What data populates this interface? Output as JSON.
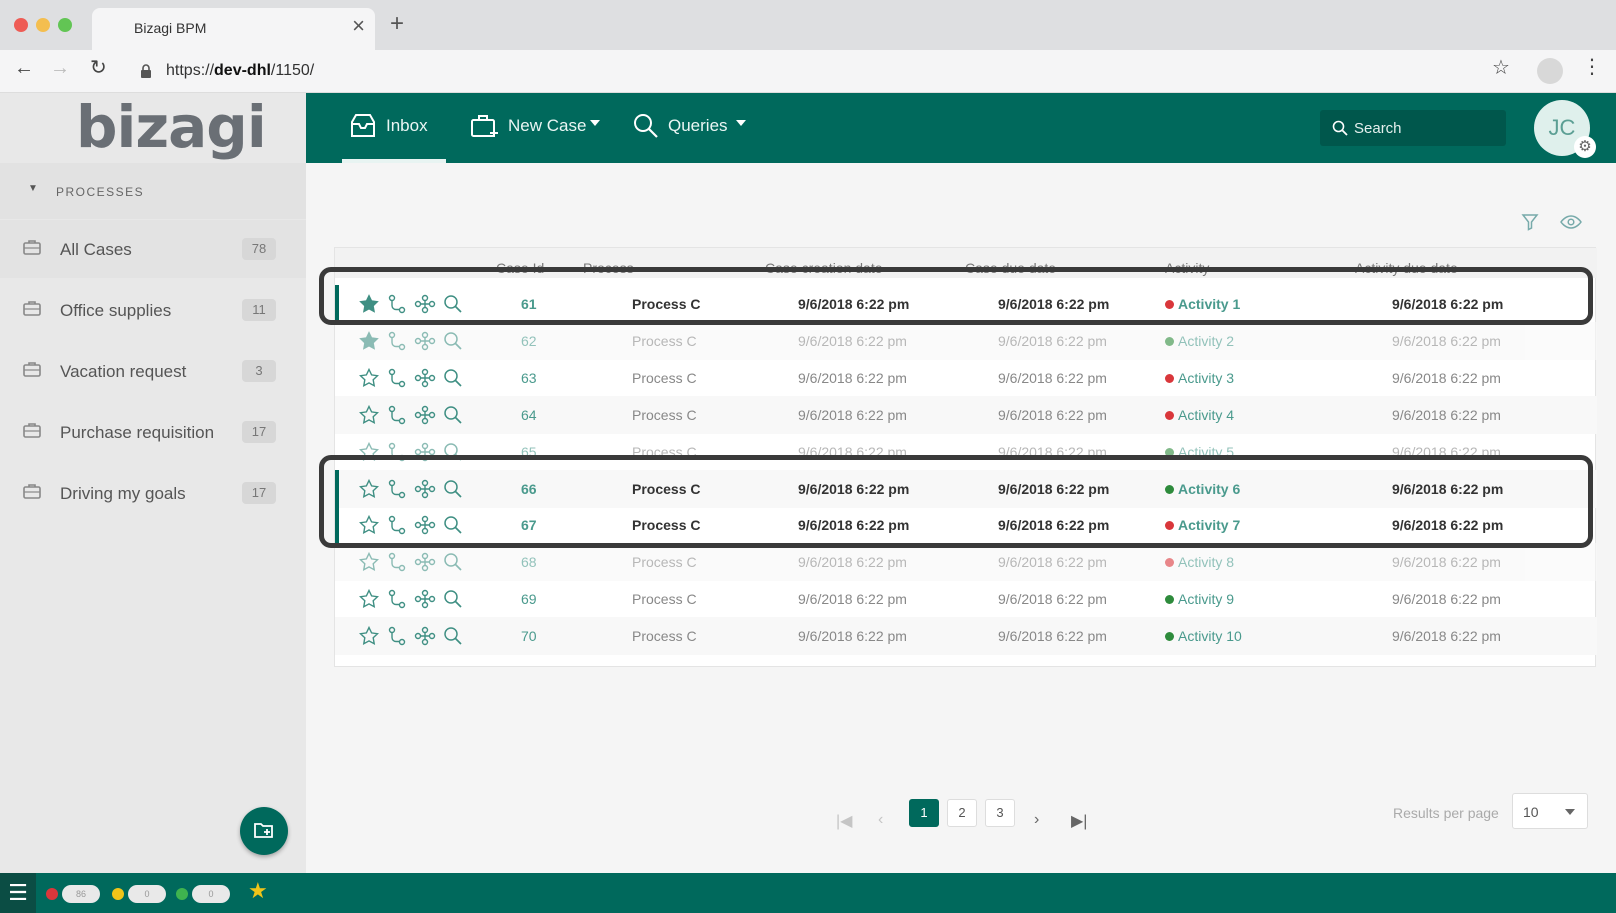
{
  "browser": {
    "tab_title": "Bizagi BPM",
    "url_prefix": "https://",
    "url_host": "dev-dhl",
    "url_path": "/1150/"
  },
  "sidebar": {
    "logo": "bizagi",
    "section_label": "PROCESSES",
    "items": [
      {
        "label": "All Cases",
        "count": "78"
      },
      {
        "label": "Office supplies",
        "count": "11"
      },
      {
        "label": "Vacation request",
        "count": "3"
      },
      {
        "label": "Purchase requisition",
        "count": "17"
      },
      {
        "label": "Driving my goals",
        "count": "17"
      }
    ]
  },
  "header": {
    "nav": [
      {
        "label": "Inbox",
        "icon": "inbox-icon",
        "active": true
      },
      {
        "label": "New Case",
        "icon": "briefcase-plus-icon"
      },
      {
        "label": "Queries",
        "icon": "search-icon"
      }
    ],
    "search_placeholder": "Search",
    "avatar_initials": "JC"
  },
  "table": {
    "columns": [
      "Case Id",
      "Process",
      "Case creation date",
      "Case due date",
      "Activity",
      "Activity due date"
    ],
    "rows": [
      {
        "id": "61",
        "process": "Process C",
        "created": "9/6/2018 6:22 pm",
        "due": "9/6/2018 6:22 pm",
        "activity": "Activity 1",
        "activity_due": "9/6/2018 6:22 pm",
        "status": "red",
        "starred": true,
        "bold": true
      },
      {
        "id": "62",
        "process": "Process C",
        "created": "9/6/2018 6:22 pm",
        "due": "9/6/2018 6:22 pm",
        "activity": "Activity 2",
        "activity_due": "9/6/2018 6:22 pm",
        "status": "green",
        "starred": true,
        "bold": false
      },
      {
        "id": "63",
        "process": "Process C",
        "created": "9/6/2018 6:22 pm",
        "due": "9/6/2018 6:22 pm",
        "activity": "Activity 3",
        "activity_due": "9/6/2018 6:22 pm",
        "status": "red",
        "starred": false,
        "bold": false
      },
      {
        "id": "64",
        "process": "Process C",
        "created": "9/6/2018 6:22 pm",
        "due": "9/6/2018 6:22 pm",
        "activity": "Activity 4",
        "activity_due": "9/6/2018 6:22 pm",
        "status": "red",
        "starred": false,
        "bold": false
      },
      {
        "id": "65",
        "process": "Process C",
        "created": "9/6/2018 6:22 pm",
        "due": "9/6/2018 6:22 pm",
        "activity": "Activity 5",
        "activity_due": "9/6/2018 6:22 pm",
        "status": "green",
        "starred": false,
        "bold": false
      },
      {
        "id": "66",
        "process": "Process C",
        "created": "9/6/2018 6:22 pm",
        "due": "9/6/2018 6:22 pm",
        "activity": "Activity 6",
        "activity_due": "9/6/2018 6:22 pm",
        "status": "green",
        "starred": false,
        "bold": true
      },
      {
        "id": "67",
        "process": "Process C",
        "created": "9/6/2018 6:22 pm",
        "due": "9/6/2018 6:22 pm",
        "activity": "Activity 7",
        "activity_due": "9/6/2018 6:22 pm",
        "status": "red",
        "starred": false,
        "bold": true
      },
      {
        "id": "68",
        "process": "Process C",
        "created": "9/6/2018 6:22 pm",
        "due": "9/6/2018 6:22 pm",
        "activity": "Activity 8",
        "activity_due": "9/6/2018 6:22 pm",
        "status": "red",
        "starred": false,
        "bold": false
      },
      {
        "id": "69",
        "process": "Process C",
        "created": "9/6/2018 6:22 pm",
        "due": "9/6/2018 6:22 pm",
        "activity": "Activity 9",
        "activity_due": "9/6/2018 6:22 pm",
        "status": "green",
        "starred": false,
        "bold": false
      },
      {
        "id": "70",
        "process": "Process C",
        "created": "9/6/2018 6:22 pm",
        "due": "9/6/2018 6:22 pm",
        "activity": "Activity 10",
        "activity_due": "9/6/2018 6:22 pm",
        "status": "green",
        "starred": false,
        "bold": false
      }
    ]
  },
  "pagination": {
    "pages": [
      "1",
      "2",
      "3"
    ],
    "current": "1",
    "results_per_page_label": "Results per page",
    "results_per_page": "10"
  },
  "bottombar": {
    "counters": [
      {
        "color": "#d9373b",
        "value": "86"
      },
      {
        "color": "#f0c419",
        "value": "0"
      },
      {
        "color": "#3fb34f",
        "value": "0"
      }
    ]
  },
  "colors": {
    "brand": "#00695c",
    "status_red": "#d9373b",
    "status_green": "#2e8b3c"
  }
}
